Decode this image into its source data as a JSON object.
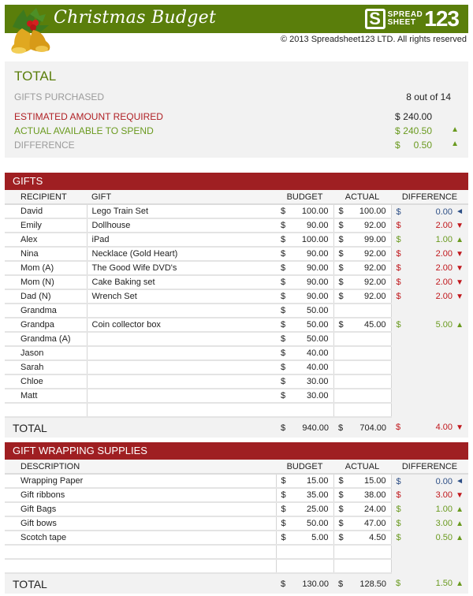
{
  "header": {
    "title": "Christmas Budget",
    "logo_word_top": "SPREAD",
    "logo_word_bottom": "SHEET",
    "logo_number": "123",
    "logo_letter": "S",
    "copyright": "© 2013 Spreadsheet123 LTD. All rights reserved",
    "brand_color": "#5a7e0b"
  },
  "summary": {
    "title": "TOTAL",
    "gifts_purchased_label": "GIFTS PURCHASED",
    "gifts_purchased_value": "8 out of 14",
    "estimated_label": "ESTIMATED AMOUNT REQUIRED",
    "estimated_currency": "$",
    "estimated_value": "240.00",
    "available_label": "ACTUAL AVAILABLE TO SPEND",
    "available_currency": "$",
    "available_value": "240.50",
    "available_arrow": "▲",
    "difference_label": "DIFFERENCE",
    "difference_currency": "$",
    "difference_value": "0.50",
    "difference_arrow": "▲"
  },
  "gifts": {
    "section_title": "GIFTS",
    "columns": [
      "RECIPIENT",
      "GIFT",
      "BUDGET",
      "ACTUAL",
      "DIFFERENCE"
    ],
    "rows": [
      {
        "recipient": "David",
        "gift": "Lego Train Set",
        "budget": "100.00",
        "actual": "100.00",
        "diff": "0.00",
        "status": "even"
      },
      {
        "recipient": "Emily",
        "gift": "Dollhouse",
        "budget": "90.00",
        "actual": "92.00",
        "diff": "2.00",
        "status": "over"
      },
      {
        "recipient": "Alex",
        "gift": "iPad",
        "budget": "100.00",
        "actual": "99.00",
        "diff": "1.00",
        "status": "under"
      },
      {
        "recipient": "Nina",
        "gift": "Necklace (Gold Heart)",
        "budget": "90.00",
        "actual": "92.00",
        "diff": "2.00",
        "status": "over"
      },
      {
        "recipient": "Mom (A)",
        "gift": "The Good Wife DVD's",
        "budget": "90.00",
        "actual": "92.00",
        "diff": "2.00",
        "status": "over"
      },
      {
        "recipient": "Mom (N)",
        "gift": "Cake Baking set",
        "budget": "90.00",
        "actual": "92.00",
        "diff": "2.00",
        "status": "over"
      },
      {
        "recipient": "Dad (N)",
        "gift": "Wrench Set",
        "budget": "90.00",
        "actual": "92.00",
        "diff": "2.00",
        "status": "over"
      },
      {
        "recipient": "Grandma",
        "gift": "",
        "budget": "50.00",
        "actual": "",
        "diff": "",
        "status": ""
      },
      {
        "recipient": "Grandpa",
        "gift": "Coin collector box",
        "budget": "50.00",
        "actual": "45.00",
        "diff": "5.00",
        "status": "under"
      },
      {
        "recipient": "Grandma (A)",
        "gift": "",
        "budget": "50.00",
        "actual": "",
        "diff": "",
        "status": ""
      },
      {
        "recipient": "Jason",
        "gift": "",
        "budget": "40.00",
        "actual": "",
        "diff": "",
        "status": ""
      },
      {
        "recipient": "Sarah",
        "gift": "",
        "budget": "40.00",
        "actual": "",
        "diff": "",
        "status": ""
      },
      {
        "recipient": "Chloe",
        "gift": "",
        "budget": "30.00",
        "actual": "",
        "diff": "",
        "status": ""
      },
      {
        "recipient": "Matt",
        "gift": "",
        "budget": "30.00",
        "actual": "",
        "diff": "",
        "status": ""
      },
      {
        "recipient": "",
        "gift": "",
        "budget": "",
        "actual": "",
        "diff": "",
        "status": ""
      }
    ],
    "total": {
      "label": "TOTAL",
      "budget": "940.00",
      "actual": "704.00",
      "diff": "4.00",
      "status": "over"
    }
  },
  "wrapping": {
    "section_title": "GIFT WRAPPING SUPPLIES",
    "columns": [
      "DESCRIPTION",
      "BUDGET",
      "ACTUAL",
      "DIFFERENCE"
    ],
    "rows": [
      {
        "description": "Wrapping Paper",
        "budget": "15.00",
        "actual": "15.00",
        "diff": "0.00",
        "status": "even"
      },
      {
        "description": "Gift ribbons",
        "budget": "35.00",
        "actual": "38.00",
        "diff": "3.00",
        "status": "over"
      },
      {
        "description": "Gift Bags",
        "budget": "25.00",
        "actual": "24.00",
        "diff": "1.00",
        "status": "under"
      },
      {
        "description": "Gift bows",
        "budget": "50.00",
        "actual": "47.00",
        "diff": "3.00",
        "status": "under"
      },
      {
        "description": "Scotch tape",
        "budget": "5.00",
        "actual": "4.50",
        "diff": "0.50",
        "status": "under"
      },
      {
        "description": "",
        "budget": "",
        "actual": "",
        "diff": "",
        "status": ""
      },
      {
        "description": "",
        "budget": "",
        "actual": "",
        "diff": "",
        "status": ""
      }
    ],
    "total": {
      "label": "TOTAL",
      "budget": "130.00",
      "actual": "128.50",
      "diff": "1.50",
      "status": "under"
    }
  },
  "currency": "$",
  "status_styles": {
    "over": {
      "arrow": "▼",
      "color": "#c0171c"
    },
    "under": {
      "arrow": "▲",
      "color": "#6a9a1f"
    },
    "even": {
      "arrow": "◄",
      "color": "#2e4f86"
    }
  }
}
